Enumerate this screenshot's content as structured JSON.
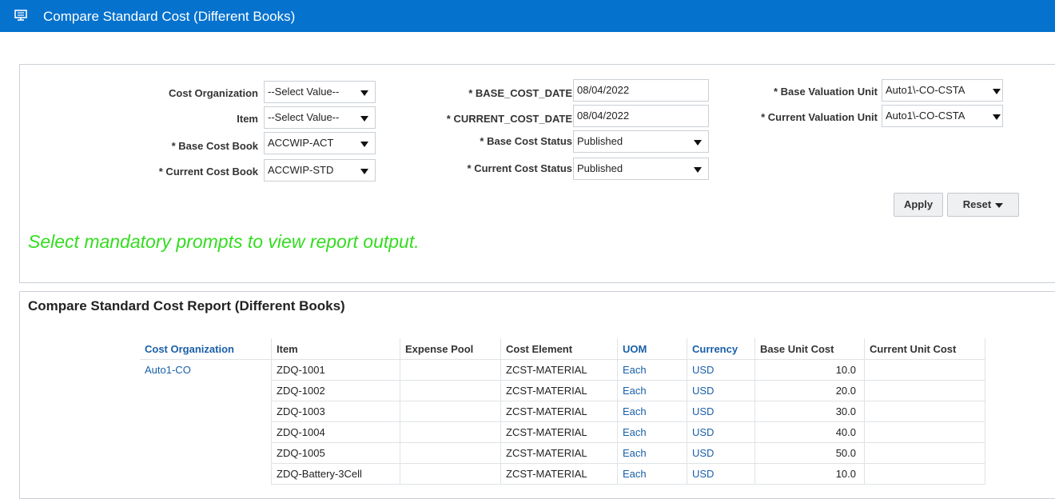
{
  "header": {
    "title": "Compare Standard Cost (Different Books)",
    "icon": "monitor-icon",
    "color": "#0572ce"
  },
  "prompts": {
    "cost_organization": {
      "label": "Cost Organization",
      "value": "--Select Value--"
    },
    "item": {
      "label": "Item",
      "value": "--Select Value--"
    },
    "base_cost_book": {
      "label": "* Base Cost Book",
      "value": "ACCWIP-ACT"
    },
    "current_cost_book": {
      "label": "* Current Cost Book",
      "value": "ACCWIP-STD"
    },
    "base_cost_date": {
      "label": "* BASE_COST_DATE",
      "value": "08/04/2022"
    },
    "current_cost_date": {
      "label": "* CURRENT_COST_DATE",
      "value": "08/04/2022"
    },
    "base_cost_status": {
      "label": "* Base Cost Status",
      "value": "Published"
    },
    "current_cost_status": {
      "label": "* Current Cost Status",
      "value": "Published"
    },
    "base_valuation_unit": {
      "label": "* Base Valuation Unit",
      "value": "Auto1\\-CO-CSTA"
    },
    "current_valuation_unit": {
      "label": "* Current Valuation Unit",
      "value": "Auto1\\-CO-CSTA"
    },
    "apply_label": "Apply",
    "reset_label": "Reset",
    "message": "Select mandatory prompts to view report output.",
    "message_color": "#33dd1f"
  },
  "report": {
    "title": "Compare Standard Cost Report (Different Books)",
    "columns": [
      "Cost Organization",
      "Item",
      "Expense Pool",
      "Cost Element",
      "UOM",
      "Currency",
      "Base Unit Cost",
      "Current Unit Cost"
    ],
    "org": "Auto1-CO",
    "rows": [
      {
        "item": "ZDQ-1001",
        "expense_pool": "",
        "cost_element": "ZCST-MATERIAL",
        "uom": "Each",
        "currency": "USD",
        "base_unit_cost": "10.0",
        "current_unit_cost": ""
      },
      {
        "item": "ZDQ-1002",
        "expense_pool": "",
        "cost_element": "ZCST-MATERIAL",
        "uom": "Each",
        "currency": "USD",
        "base_unit_cost": "20.0",
        "current_unit_cost": ""
      },
      {
        "item": "ZDQ-1003",
        "expense_pool": "",
        "cost_element": "ZCST-MATERIAL",
        "uom": "Each",
        "currency": "USD",
        "base_unit_cost": "30.0",
        "current_unit_cost": ""
      },
      {
        "item": "ZDQ-1004",
        "expense_pool": "",
        "cost_element": "ZCST-MATERIAL",
        "uom": "Each",
        "currency": "USD",
        "base_unit_cost": "40.0",
        "current_unit_cost": ""
      },
      {
        "item": "ZDQ-1005",
        "expense_pool": "",
        "cost_element": "ZCST-MATERIAL",
        "uom": "Each",
        "currency": "USD",
        "base_unit_cost": "50.0",
        "current_unit_cost": ""
      },
      {
        "item": "ZDQ-Battery-3Cell",
        "expense_pool": "",
        "cost_element": "ZCST-MATERIAL",
        "uom": "Each",
        "currency": "USD",
        "base_unit_cost": "10.0",
        "current_unit_cost": ""
      }
    ]
  }
}
